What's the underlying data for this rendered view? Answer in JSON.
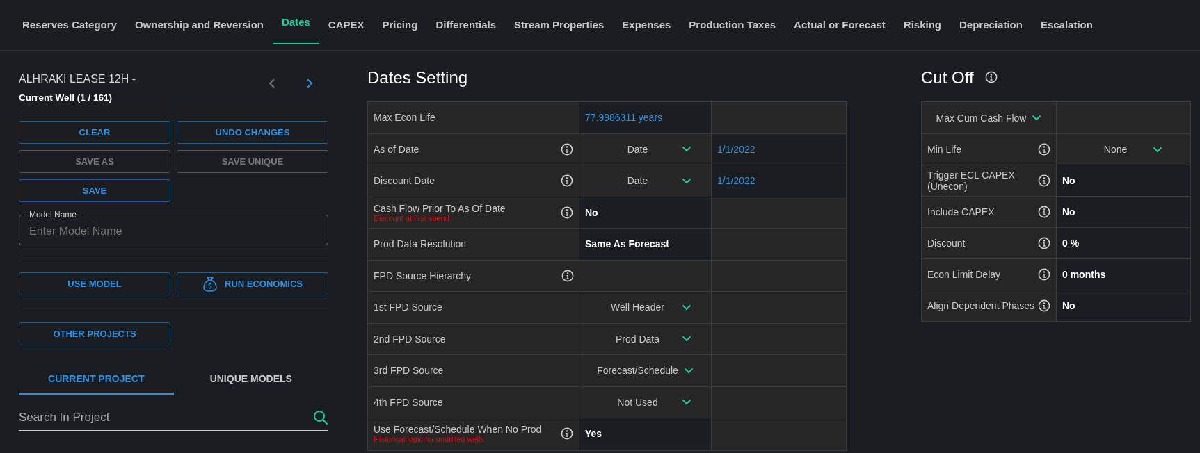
{
  "nav": {
    "tabs": [
      {
        "label": "Reserves Category",
        "selected": false
      },
      {
        "label": "Ownership and Reversion",
        "selected": false
      },
      {
        "label": "Dates",
        "selected": true
      },
      {
        "label": "CAPEX",
        "selected": false
      },
      {
        "label": "Pricing",
        "selected": false
      },
      {
        "label": "Differentials",
        "selected": false
      },
      {
        "label": "Stream Properties",
        "selected": false
      },
      {
        "label": "Expenses",
        "selected": false
      },
      {
        "label": "Production Taxes",
        "selected": false
      },
      {
        "label": "Actual or Forecast",
        "selected": false
      },
      {
        "label": "Risking",
        "selected": false
      },
      {
        "label": "Depreciation",
        "selected": false
      },
      {
        "label": "Escalation",
        "selected": false
      }
    ]
  },
  "sidebar": {
    "well_name": "ALHRAKI LEASE 12H -",
    "well_position": "Current Well (1 / 161)",
    "prev_disabled": true,
    "next_disabled": false,
    "button_groups": [
      [
        {
          "label": "CLEAR",
          "disabled": false
        },
        {
          "label": "UNDO CHANGES",
          "disabled": false
        },
        {
          "label": "SAVE AS",
          "disabled": true
        },
        {
          "label": "SAVE UNIQUE",
          "disabled": true
        },
        {
          "label": "SAVE",
          "disabled": false
        }
      ],
      [
        {
          "label": "USE MODEL",
          "disabled": false,
          "icon": false
        },
        {
          "label": "RUN ECONOMICS",
          "disabled": false,
          "icon": true
        }
      ],
      [
        {
          "label": "OTHER PROJECTS",
          "disabled": false
        }
      ]
    ],
    "model_name": {
      "label": "Model Name",
      "placeholder": "Enter Model Name"
    },
    "tabs": [
      {
        "label": "CURRENT PROJECT",
        "selected": true
      },
      {
        "label": "UNIQUE MODELS",
        "selected": false
      }
    ],
    "search": {
      "placeholder": "Search In Project"
    }
  },
  "dates_setting": {
    "title": "Dates Setting",
    "rows": [
      {
        "label": "Max Econ Life",
        "info": false,
        "kind": "link",
        "value": "77.9986311 years"
      },
      {
        "label": "As of Date",
        "info": true,
        "kind": "select",
        "value": "Date",
        "date": "1/1/2022"
      },
      {
        "label": "Discount Date",
        "info": true,
        "kind": "select",
        "value": "Date",
        "date": "1/1/2022"
      },
      {
        "label": "Cash Flow Prior To As Of Date",
        "note": "Discount at first spend",
        "info": true,
        "kind": "plain",
        "value": "No"
      },
      {
        "label": "Prod Data Resolution",
        "info": false,
        "kind": "plain",
        "value": "Same As Forecast"
      },
      {
        "label": "FPD Source Hierarchy",
        "info": true,
        "kind": "group"
      },
      {
        "label": "1st FPD Source",
        "info": false,
        "kind": "select",
        "value": "Well Header"
      },
      {
        "label": "2nd FPD Source",
        "info": false,
        "kind": "select",
        "value": "Prod Data"
      },
      {
        "label": "3rd FPD Source",
        "info": false,
        "kind": "select",
        "value": "Forecast/Schedule"
      },
      {
        "label": "4th FPD Source",
        "info": false,
        "kind": "select",
        "value": "Not Used"
      },
      {
        "label": "Use Forecast/Schedule When No Prod",
        "note": "Historical logic for undrilled wells",
        "info": true,
        "kind": "plain",
        "value": "Yes"
      }
    ]
  },
  "cut_off": {
    "title": "Cut Off",
    "criterion": "Max Cum Cash Flow",
    "rows": [
      {
        "label": "Min Life",
        "kind": "select",
        "value": "None"
      },
      {
        "label": "Trigger ECL CAPEX (Unecon)",
        "kind": "plain",
        "value": "No"
      },
      {
        "label": "Include CAPEX",
        "kind": "plain",
        "value": "No"
      },
      {
        "label": "Discount",
        "kind": "plain",
        "value": "0 %"
      },
      {
        "label": "Econ Limit Delay",
        "kind": "plain",
        "value": "0 months"
      },
      {
        "label": "Align Dependent Phases",
        "kind": "plain",
        "value": "No"
      }
    ]
  }
}
